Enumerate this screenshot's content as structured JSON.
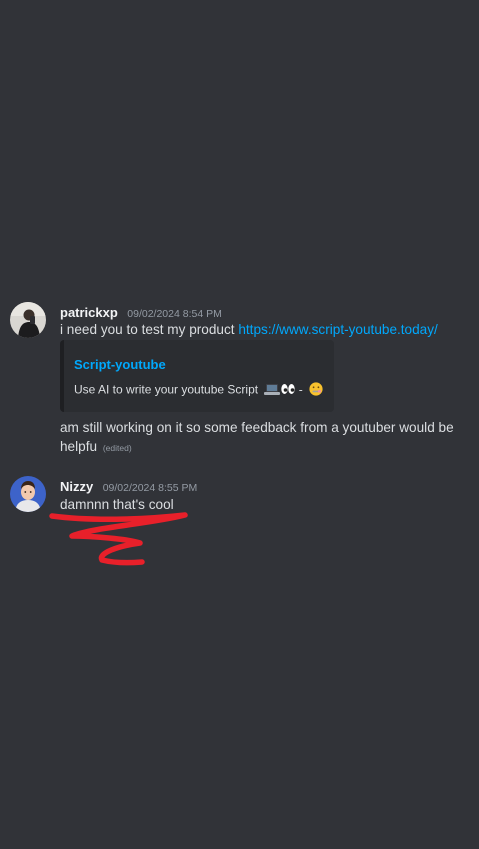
{
  "messages": [
    {
      "username": "patrickxp",
      "timestamp": "09/02/2024 8:54 PM",
      "text_prefix": "i need you to test my product",
      "link": "https://www.script-youtube.today/",
      "embed": {
        "title": "Script-youtube",
        "description": "Use AI to write your youtube Script",
        "separator": "-",
        "emojis": [
          "laptop-emoji",
          "eyes-emoji",
          "zipper-mouth-emoji"
        ]
      },
      "followup_text": "am still working on it so some feedback from a youtuber would be helpfu",
      "edited_label": "(edited)"
    },
    {
      "username": "Nizzy",
      "timestamp": "09/02/2024 8:55 PM",
      "text": "damnnn that's cool"
    }
  ],
  "colors": {
    "background": "#313338",
    "link": "#00a8fc",
    "embed_background": "#2b2d31",
    "annotation": "#e8202a"
  }
}
